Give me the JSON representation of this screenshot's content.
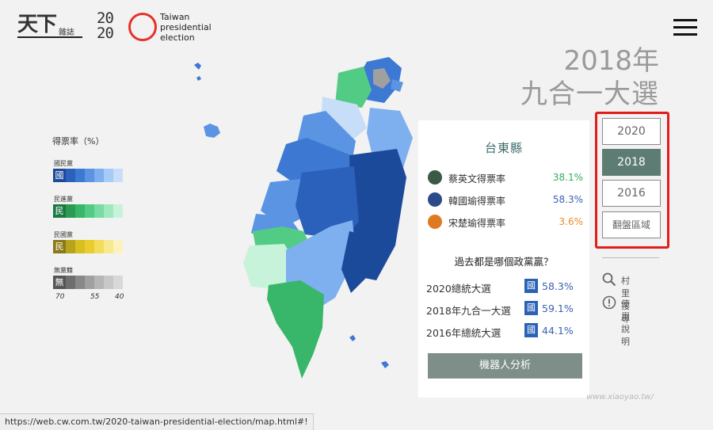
{
  "brand": {
    "cw_logo": "天下",
    "cw_sub": "雜誌",
    "logo_2020_top": "20",
    "logo_2020_bottom": "20",
    "logo_text": [
      "Taiwan",
      "presidential",
      "election"
    ]
  },
  "headline": {
    "year": "2018年",
    "title": "九合一大選"
  },
  "legend": {
    "title": "得票率（%）",
    "groups": [
      {
        "label": "國民黨",
        "badge": "國",
        "colors": [
          "#1c4a9a",
          "#2b60bb",
          "#3d78d2",
          "#5b94e2",
          "#7eafee",
          "#a6cbf6",
          "#c8def8"
        ]
      },
      {
        "label": "民進黨",
        "badge": "民",
        "colors": [
          "#1b7a43",
          "#2a9a55",
          "#38b76a",
          "#52cc85",
          "#78dba2",
          "#a0e8be",
          "#c6f3da"
        ]
      },
      {
        "label": "民國黨",
        "badge": "民",
        "colors": [
          "#8a7a16",
          "#b8a41c",
          "#d8be1e",
          "#ebcc2e",
          "#f3dc5c",
          "#f8e88e",
          "#fbf2bf"
        ]
      },
      {
        "label": "無黨籍",
        "badge": "無",
        "colors": [
          "#555555",
          "#6e6e6e",
          "#888888",
          "#a0a0a0",
          "#b6b6b6",
          "#c8c8c8",
          "#d8d8d8"
        ]
      }
    ],
    "ticks": [
      "70",
      "55",
      "40"
    ]
  },
  "panel": {
    "county": "台東縣",
    "candidates": [
      {
        "name": "蔡英文得票率",
        "pct": "38.1%",
        "color": "#2fae5b",
        "avatar": "#3a5a46"
      },
      {
        "name": "韓國瑜得票率",
        "pct": "58.3%",
        "color": "#3a62b0",
        "avatar": "#2b4a8a"
      },
      {
        "name": "宋楚瑜得票率",
        "pct": "3.6%",
        "color": "#ee8a2a",
        "avatar": "#e07a22"
      }
    ],
    "question": "過去都是哪個政黨贏？",
    "history": [
      {
        "label": "2020總統大選",
        "badge": "國",
        "value": "58.3%"
      },
      {
        "label": "2018年九合一大選",
        "badge": "國",
        "value": "59.1%"
      },
      {
        "label": "2016年總統大選",
        "badge": "國",
        "value": "44.1%"
      }
    ],
    "robot_button": "機器人分析"
  },
  "year_buttons": {
    "y2020": "2020",
    "y2018": "2018",
    "y2016": "2016",
    "flip": "翻盤區域",
    "active": "2018"
  },
  "side_links": {
    "search": "村里搜尋",
    "help": "使用說明"
  },
  "status_url": "https://web.cw.com.tw/2020-taiwan-presidential-election/map.html#!",
  "watermark": "www.xiaoyao.tw/"
}
